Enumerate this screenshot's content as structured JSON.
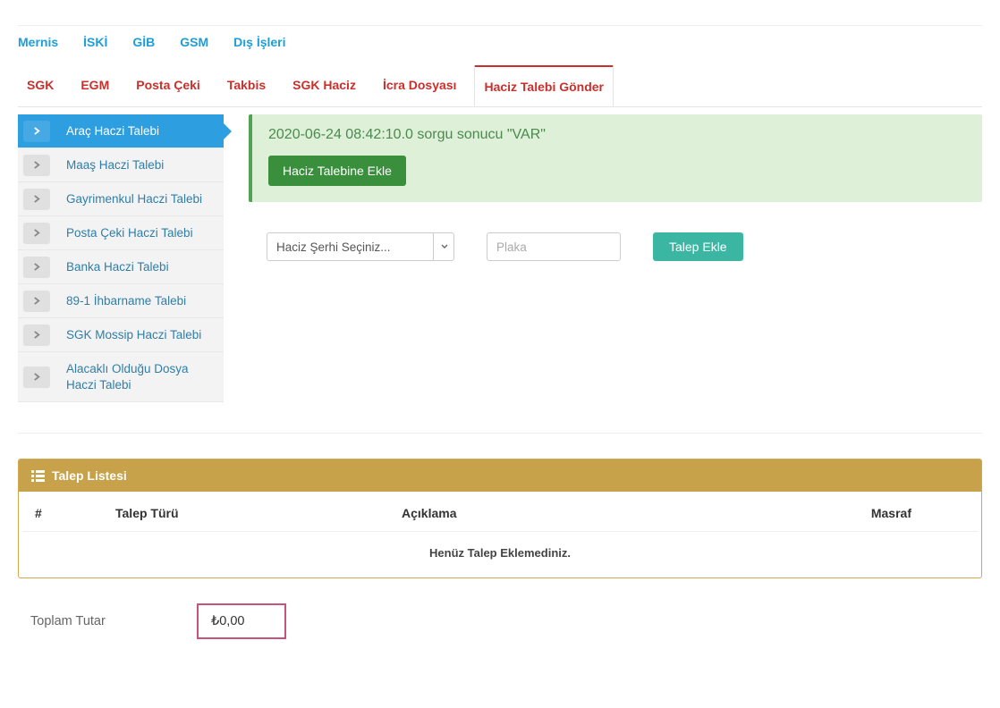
{
  "tabs_top": [
    "Mernis",
    "İSKİ",
    "GİB",
    "GSM",
    "Dış İşleri"
  ],
  "tabs_main": [
    {
      "label": "SGK"
    },
    {
      "label": "EGM"
    },
    {
      "label": "Posta Çeki"
    },
    {
      "label": "Takbis"
    },
    {
      "label": "SGK Haciz"
    },
    {
      "label": "İcra Dosyası"
    },
    {
      "label": "Haciz Talebi Gönder",
      "active": true
    }
  ],
  "sidebar": [
    {
      "label": "Araç Haczi Talebi",
      "active": true
    },
    {
      "label": "Maaş Haczi Talebi"
    },
    {
      "label": "Gayrimenkul Haczi Talebi"
    },
    {
      "label": "Posta Çeki Haczi Talebi"
    },
    {
      "label": "Banka Haczi Talebi"
    },
    {
      "label": "89-1 İhbarname Talebi"
    },
    {
      "label": "SGK Mossip Haczi Talebi"
    },
    {
      "label": "Alacaklı Olduğu Dosya Haczi Talebi"
    }
  ],
  "alert": {
    "text": "2020-06-24 08:42:10.0 sorgu sonucu \"VAR\"",
    "button": "Haciz Talebine Ekle"
  },
  "form": {
    "select_placeholder": "Haciz Şerhi Seçiniz...",
    "plaka_placeholder": "Plaka",
    "add_button": "Talep Ekle"
  },
  "panel": {
    "title": "Talep Listesi",
    "columns": [
      "#",
      "Talep Türü",
      "Açıklama",
      "Masraf"
    ],
    "empty_text": "Henüz Talep Eklemediniz."
  },
  "total": {
    "label": "Toplam Tutar",
    "value": "₺0,00"
  }
}
